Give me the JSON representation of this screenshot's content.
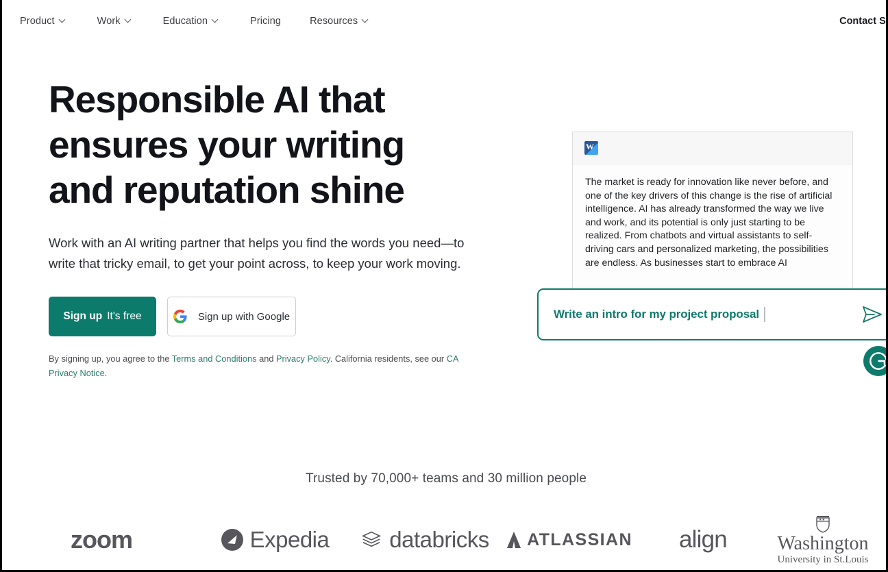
{
  "nav": {
    "items": [
      {
        "label": "Product",
        "has_chevron": true,
        "icon": "chevron-down-icon"
      },
      {
        "label": "Work",
        "has_chevron": true,
        "icon": "chevron-down-icon"
      },
      {
        "label": "Education",
        "has_chevron": true,
        "icon": "chevron-down-icon"
      },
      {
        "label": "Pricing",
        "has_chevron": false,
        "icon": ""
      },
      {
        "label": "Resources",
        "has_chevron": true,
        "icon": "chevron-down-icon"
      }
    ],
    "contact": "Contact Sales"
  },
  "hero": {
    "headline": "Responsible AI that ensures your writing and reputation shine",
    "subhead": "Work with an AI writing partner that helps you find the words you need—to write that tricky email, to get your point across, to keep your work moving.",
    "signup_button": {
      "strong": "Sign up",
      "suffix": "It's free"
    },
    "google_button": {
      "label": "Sign up with Google",
      "icon": "google-icon"
    },
    "legal": {
      "part1": "By signing up, you agree to the ",
      "link1": "Terms and Conditions",
      "part2": " and ",
      "link2": "Privacy Policy",
      "part3": ". California residents, see our ",
      "link3": "CA Privacy Notice",
      "part4": "."
    }
  },
  "doc_mock": {
    "app_icon": "microsoft-word-icon",
    "body": "The market is ready for innovation like never before, and one of the key drivers of this change is the rise of artificial intelligence. AI has already transformed the way we live and work, and its potential is only just starting to be realized. From chatbots and virtual assistants to self-driving cars and personalized marketing, the possibilities are endless. As businesses start to embrace AI"
  },
  "prompt_bar": {
    "text": "Write an intro for my project proposal",
    "send_icon": "send-paper-plane-icon",
    "badge_icon": "grammarly-g-icon"
  },
  "trusted": {
    "text": "Trusted by 70,000+ teams and 30 million people"
  },
  "logos": [
    {
      "name": "zoom",
      "label": "zoom"
    },
    {
      "name": "expedia",
      "label": "Expedia"
    },
    {
      "name": "databricks",
      "label": "databricks"
    },
    {
      "name": "atlassian",
      "label": "ATLASSIAN"
    },
    {
      "name": "align",
      "label": "align"
    },
    {
      "name": "washington-university",
      "label": "Washington",
      "sub": "University in St.Louis"
    }
  ],
  "colors": {
    "brand_teal": "#0c7b6c",
    "text_dark": "#13141a",
    "link_teal": "#2c7a6e",
    "logo_gray": "#56565c"
  }
}
